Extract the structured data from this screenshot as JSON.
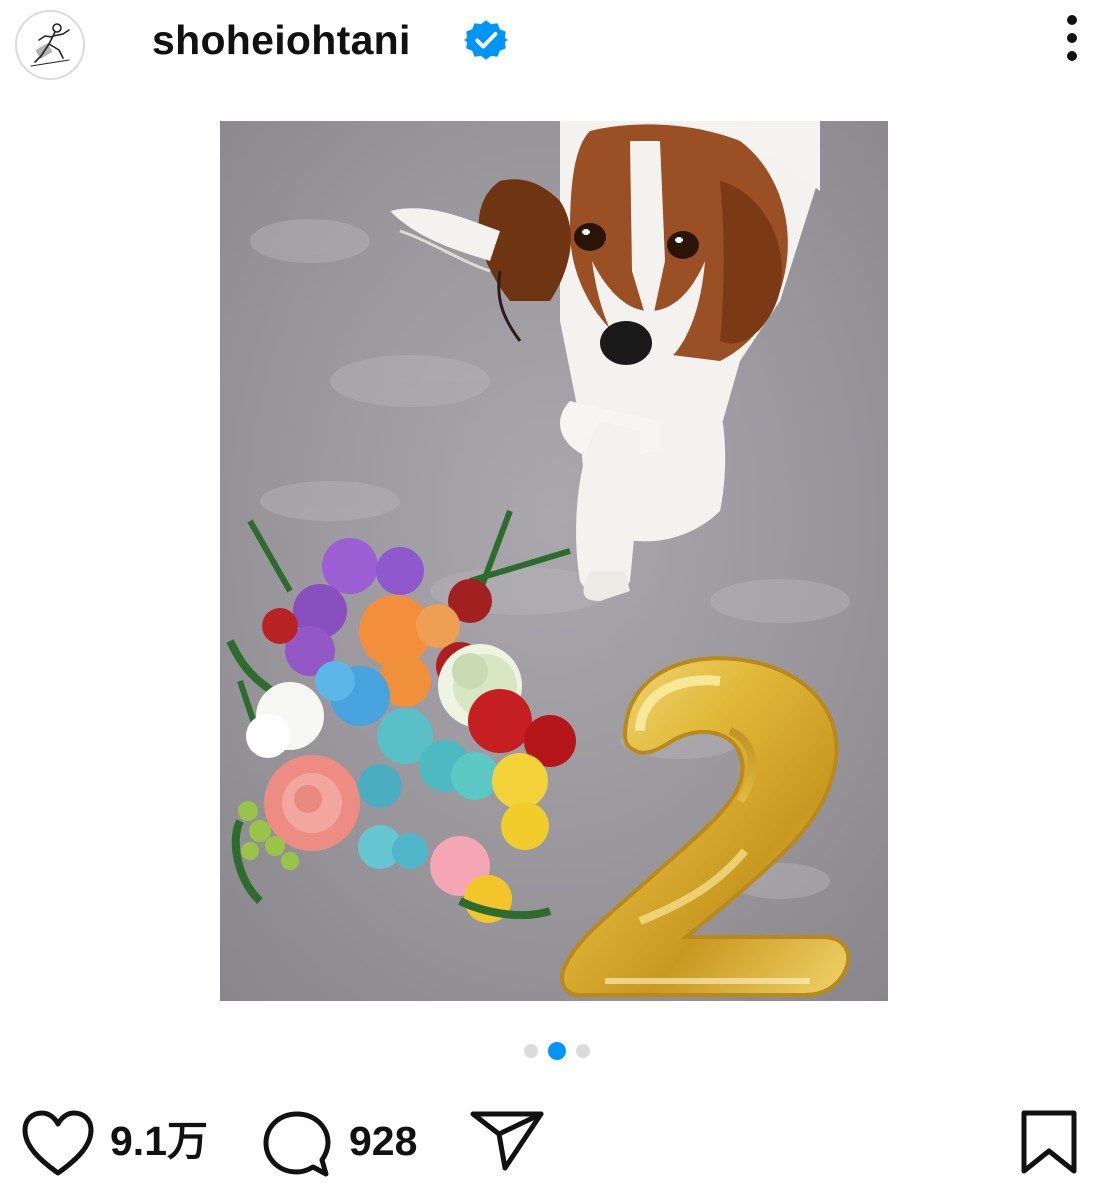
{
  "post": {
    "username": "shoheiohtani",
    "verified_badge_icon": "verified-badge-icon",
    "menu_icon": "more-vertical-icon",
    "carousel_dots": 3,
    "carousel_active_index": 1
  },
  "actions": {
    "like_icon": "heart-icon",
    "like_count": "9.1万",
    "comment_icon": "comment-icon",
    "comment_count": "928",
    "share_icon": "send-icon",
    "save_icon": "bookmark-icon"
  },
  "colors": {
    "accent": "#0095f6",
    "verified": "#0095f6",
    "text": "#111111",
    "inactive_dot": "#dbdbdb"
  }
}
